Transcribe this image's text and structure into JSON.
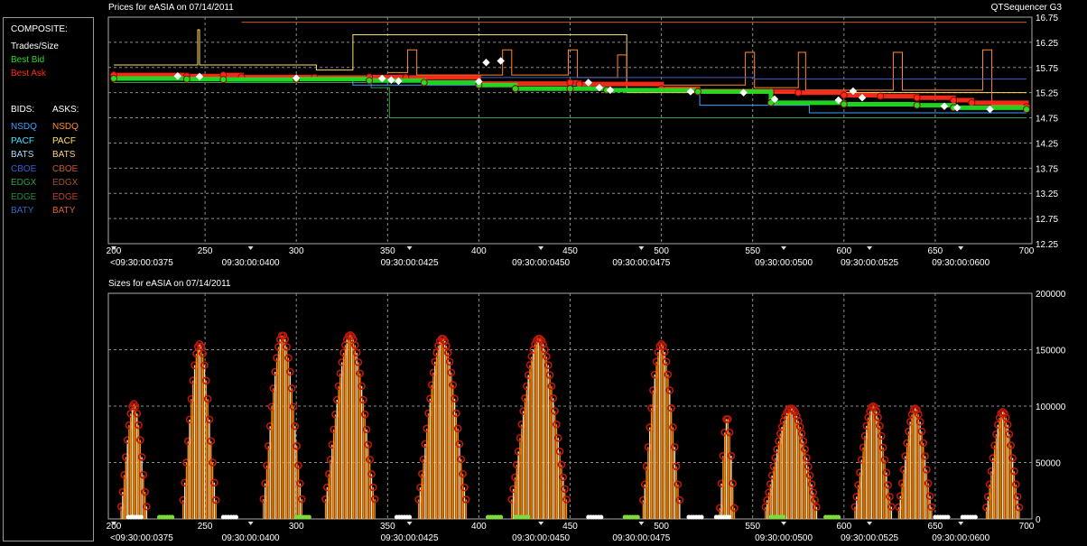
{
  "app": {
    "name": "QTSequencer G3"
  },
  "legend": {
    "composite_label": "COMPOSITE:",
    "trades_label": "Trades/Size",
    "best_bid_label": "Best Bid",
    "best_ask_label": "Best Ask",
    "bids_header": "BIDS:",
    "asks_header": "ASKS:",
    "exchanges": [
      {
        "bid": "NSDQ",
        "ask": "NSDQ",
        "bid_color": "#3fa0ff",
        "ask_color": "#ff8a2a"
      },
      {
        "bid": "PACF",
        "ask": "PACF",
        "bid_color": "#40e0ff",
        "ask_color": "#ffe066"
      },
      {
        "bid": "BATS",
        "ask": "BATS",
        "bid_color": "#a8d8ff",
        "ask_color": "#ffd27f"
      },
      {
        "bid": "CBOE",
        "ask": "CBOE",
        "bid_color": "#3a5fd0",
        "ask_color": "#c85a28"
      },
      {
        "bid": "EDGX",
        "ask": "EDGX",
        "bid_color": "#2ea043",
        "ask_color": "#a0522d"
      },
      {
        "bid": "EDGE",
        "ask": "EDGE",
        "bid_color": "#1e8c3a",
        "ask_color": "#c0402a"
      },
      {
        "bid": "BATY",
        "ask": "BATY",
        "bid_color": "#4060c8",
        "ask_color": "#e06030"
      }
    ],
    "colors": {
      "trades": "#ffffff",
      "best_bid": "#22dd22",
      "best_ask": "#ff2a1a"
    }
  },
  "chart_data": [
    {
      "type": "line",
      "title": "Prices for  eASIA  on  07/14/2011",
      "ylim": [
        12.25,
        16.75
      ],
      "yticks": [
        "16.75",
        "16.25",
        "15.75",
        "15.25",
        "14.75",
        "14.25",
        "13.75",
        "13.25",
        "12.75",
        "12.25"
      ],
      "xlim": [
        200,
        700
      ],
      "xticks": [
        "200",
        "250",
        "300",
        "350",
        "400",
        "450",
        "500",
        "550",
        "600",
        "650",
        "700"
      ],
      "time_labels": [
        {
          "x": 200,
          "label": "<09:30:00:0375"
        },
        {
          "x": 275,
          "label": "09:30:00:0400"
        },
        {
          "x": 362,
          "label": "09:30:00:0425"
        },
        {
          "x": 434,
          "label": "09:30:00:0450"
        },
        {
          "x": 489,
          "label": "09:30:00:0475"
        },
        {
          "x": 567,
          "label": "09:30:00:0500"
        },
        {
          "x": 614,
          "label": "09:30:00:0525"
        },
        {
          "x": 664,
          "label": "09:30:00:0600"
        }
      ],
      "grid": true,
      "series": [
        {
          "name": "Best Ask",
          "color": "#ff2a1a",
          "points": [
            [
              200,
              15.6
            ],
            [
              240,
              15.58
            ],
            [
              260,
              15.6
            ],
            [
              270,
              15.56
            ],
            [
              310,
              15.55
            ],
            [
              340,
              15.56
            ],
            [
              360,
              15.55
            ],
            [
              400,
              15.43
            ],
            [
              450,
              15.45
            ],
            [
              455,
              15.42
            ],
            [
              500,
              15.33
            ],
            [
              520,
              15.28
            ],
            [
              560,
              15.27
            ],
            [
              575,
              15.25
            ],
            [
              600,
              15.2
            ],
            [
              620,
              15.18
            ],
            [
              640,
              15.15
            ],
            [
              660,
              15.1
            ],
            [
              670,
              15.05
            ],
            [
              700,
              14.97
            ]
          ]
        },
        {
          "name": "Best Bid",
          "color": "#22dd22",
          "points": [
            [
              200,
              15.53
            ],
            [
              240,
              15.52
            ],
            [
              260,
              15.51
            ],
            [
              300,
              15.52
            ],
            [
              340,
              15.49
            ],
            [
              370,
              15.45
            ],
            [
              400,
              15.4
            ],
            [
              420,
              15.33
            ],
            [
              450,
              15.33
            ],
            [
              470,
              15.3
            ],
            [
              520,
              15.27
            ],
            [
              560,
              15.05
            ],
            [
              600,
              15.02
            ],
            [
              640,
              15.0
            ],
            [
              660,
              14.95
            ],
            [
              700,
              14.92
            ]
          ]
        },
        {
          "name": "Trades/Size",
          "color": "#ffffff",
          "points": [
            [
              235,
              15.58
            ],
            [
              247,
              15.57
            ],
            [
              300,
              15.54
            ],
            [
              347,
              15.53
            ],
            [
              352,
              15.5
            ],
            [
              356,
              15.48
            ],
            [
              400,
              15.47
            ],
            [
              404,
              15.85
            ],
            [
              412,
              15.88
            ],
            [
              460,
              15.45
            ],
            [
              466,
              15.35
            ],
            [
              472,
              15.3
            ],
            [
              516,
              15.27
            ],
            [
              545,
              15.25
            ],
            [
              562,
              15.12
            ],
            [
              597,
              15.1
            ],
            [
              605,
              15.28
            ],
            [
              610,
              15.15
            ],
            [
              655,
              14.98
            ],
            [
              662,
              14.95
            ],
            [
              680,
              14.92
            ]
          ]
        }
      ]
    },
    {
      "type": "bar",
      "title": "Sizes for  eASIA  on  07/14/2011",
      "ylim": [
        0,
        200000
      ],
      "yticks": [
        "200000",
        "150000",
        "100000",
        "50000",
        "0"
      ],
      "xlim": [
        200,
        700
      ],
      "xticks": [
        "200",
        "250",
        "300",
        "350",
        "400",
        "450",
        "500",
        "550",
        "600",
        "650",
        "700"
      ],
      "time_labels": [
        {
          "x": 200,
          "label": "<09:30:00:0375"
        },
        {
          "x": 275,
          "label": "09:30:00:0400"
        },
        {
          "x": 362,
          "label": "09:30:00:0425"
        },
        {
          "x": 434,
          "label": "09:30:00:0450"
        },
        {
          "x": 489,
          "label": "09:30:00:0475"
        },
        {
          "x": 567,
          "label": "09:30:00:0500"
        },
        {
          "x": 614,
          "label": "09:30:00:0525"
        },
        {
          "x": 664,
          "label": "09:30:00:0600"
        }
      ],
      "grid": true,
      "bursts": [
        {
          "start": 204,
          "end": 218,
          "peak": 102000
        },
        {
          "start": 238,
          "end": 256,
          "peak": 155000
        },
        {
          "start": 282,
          "end": 303,
          "peak": 163000
        },
        {
          "start": 316,
          "end": 343,
          "peak": 163000
        },
        {
          "start": 367,
          "end": 393,
          "peak": 160000
        },
        {
          "start": 418,
          "end": 448,
          "peak": 160000
        },
        {
          "start": 490,
          "end": 510,
          "peak": 155000
        },
        {
          "start": 532,
          "end": 540,
          "peak": 90000
        },
        {
          "start": 557,
          "end": 585,
          "peak": 98000
        },
        {
          "start": 606,
          "end": 626,
          "peak": 100000
        },
        {
          "start": 630,
          "end": 648,
          "peak": 98000
        },
        {
          "start": 678,
          "end": 696,
          "peak": 95000
        }
      ],
      "bar_colors": {
        "stem_orange": "#ff8c00",
        "stem_light": "#ffe0c0",
        "marker": "#c01808"
      }
    }
  ]
}
